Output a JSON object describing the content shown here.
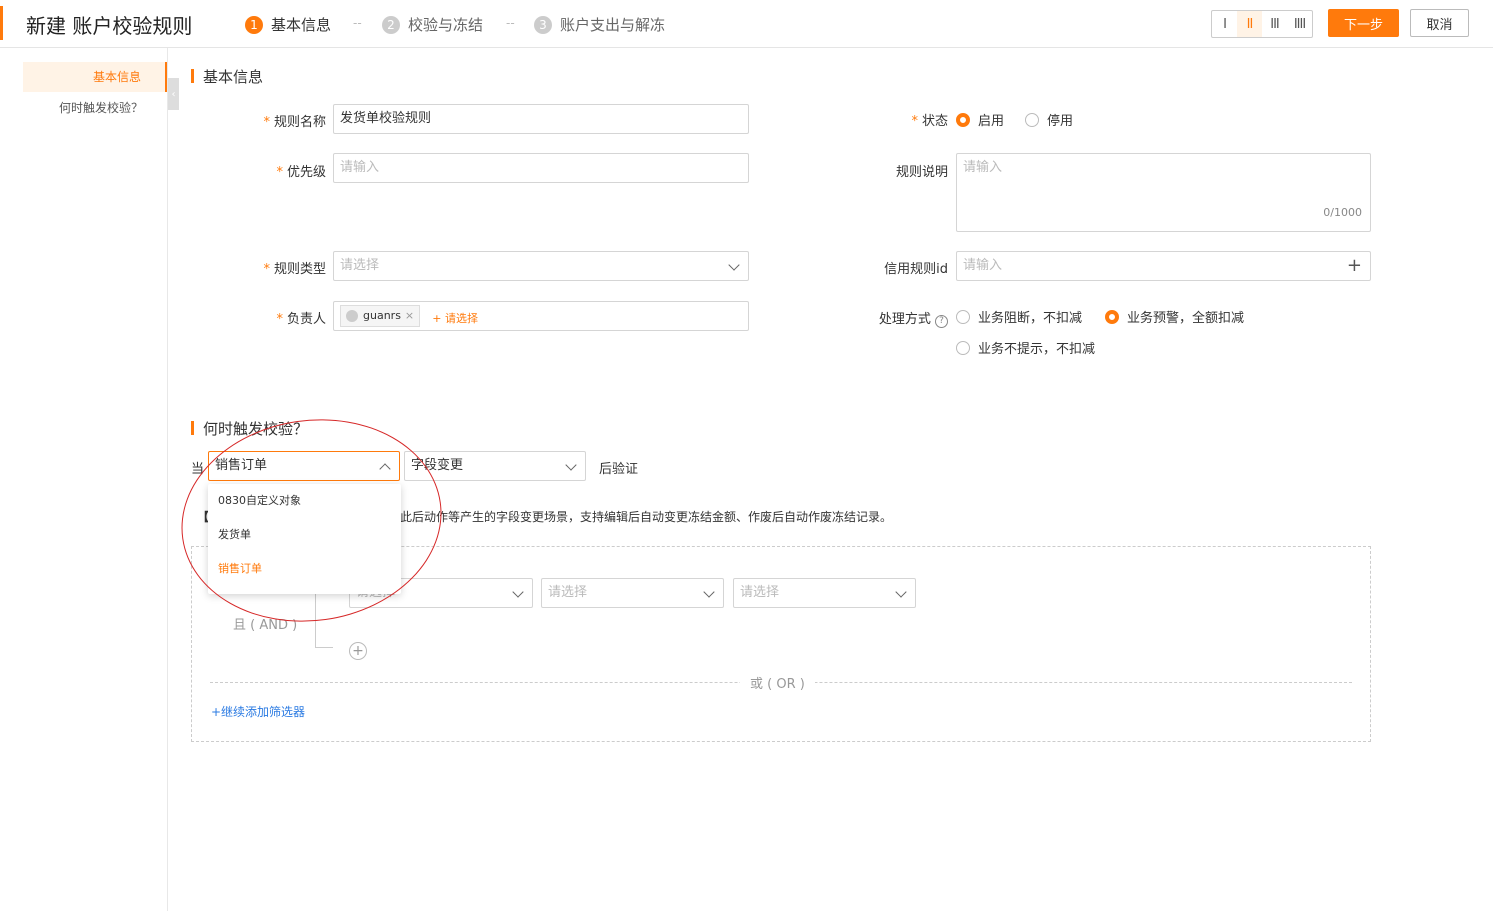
{
  "header": {
    "title": "新建 账户校验规则",
    "steps": [
      {
        "num": "1",
        "label": "基本信息"
      },
      {
        "num": "2",
        "label": "校验与冻结"
      },
      {
        "num": "3",
        "label": "账户支出与解冻"
      }
    ],
    "step_separator": "--",
    "layout_options": [
      "I",
      "II",
      "III",
      "IIII"
    ],
    "next_label": "下一步",
    "cancel_label": "取消"
  },
  "sidebar": {
    "items": [
      {
        "label": "基本信息"
      },
      {
        "label": "何时触发校验？"
      }
    ]
  },
  "basic": {
    "section_title": "基本信息",
    "rule_name": {
      "label": "规则名称",
      "value": "发货单校验规则"
    },
    "priority": {
      "label": "优先级",
      "placeholder": "请输入"
    },
    "rule_type": {
      "label": "规则类型",
      "placeholder": "请选择"
    },
    "owner": {
      "label": "负责人",
      "tag": "guanrs",
      "tag_remove": "×",
      "add_label": "+ 请选择"
    },
    "status": {
      "label": "状态",
      "options": [
        "启用",
        "停用"
      ],
      "selected": "启用"
    },
    "description": {
      "label": "规则说明",
      "placeholder": "请输入",
      "counter": "0/1000"
    },
    "credit_rule_id": {
      "label": "信用规则id",
      "placeholder": "请输入",
      "plus": "+"
    },
    "handling": {
      "label": "处理方式",
      "help": "?",
      "options": [
        "业务阻断，不扣减",
        "业务预警，全额扣减",
        "业务不提示，不扣减"
      ],
      "selected": "业务预警，全额扣减"
    }
  },
  "trigger": {
    "section_title": "何时触发校验？",
    "prefix": "当",
    "object_select": {
      "value": "销售订单"
    },
    "event_select": {
      "value": "字段变更"
    },
    "suffix": "后验证",
    "dropdown_options": [
      "0830自定义对象",
      "发货单",
      "销售订单"
    ],
    "dropdown_selected": "销售订单",
    "note_prefix": "【",
    "note_text": "此后动作等产生的字段变更场景，支持编辑后自动变更冻结金额、作废后自动作废冻结记录。",
    "filter": {
      "and_label": "且 ( AND )",
      "or_label": "或 ( OR )",
      "select_placeholder": "请选择",
      "add_label": "+继续添加筛选器",
      "add_circle": "+"
    }
  },
  "colors": {
    "accent": "#ff7a0c",
    "link": "#2a7ae2",
    "annotation": "#d62828"
  }
}
